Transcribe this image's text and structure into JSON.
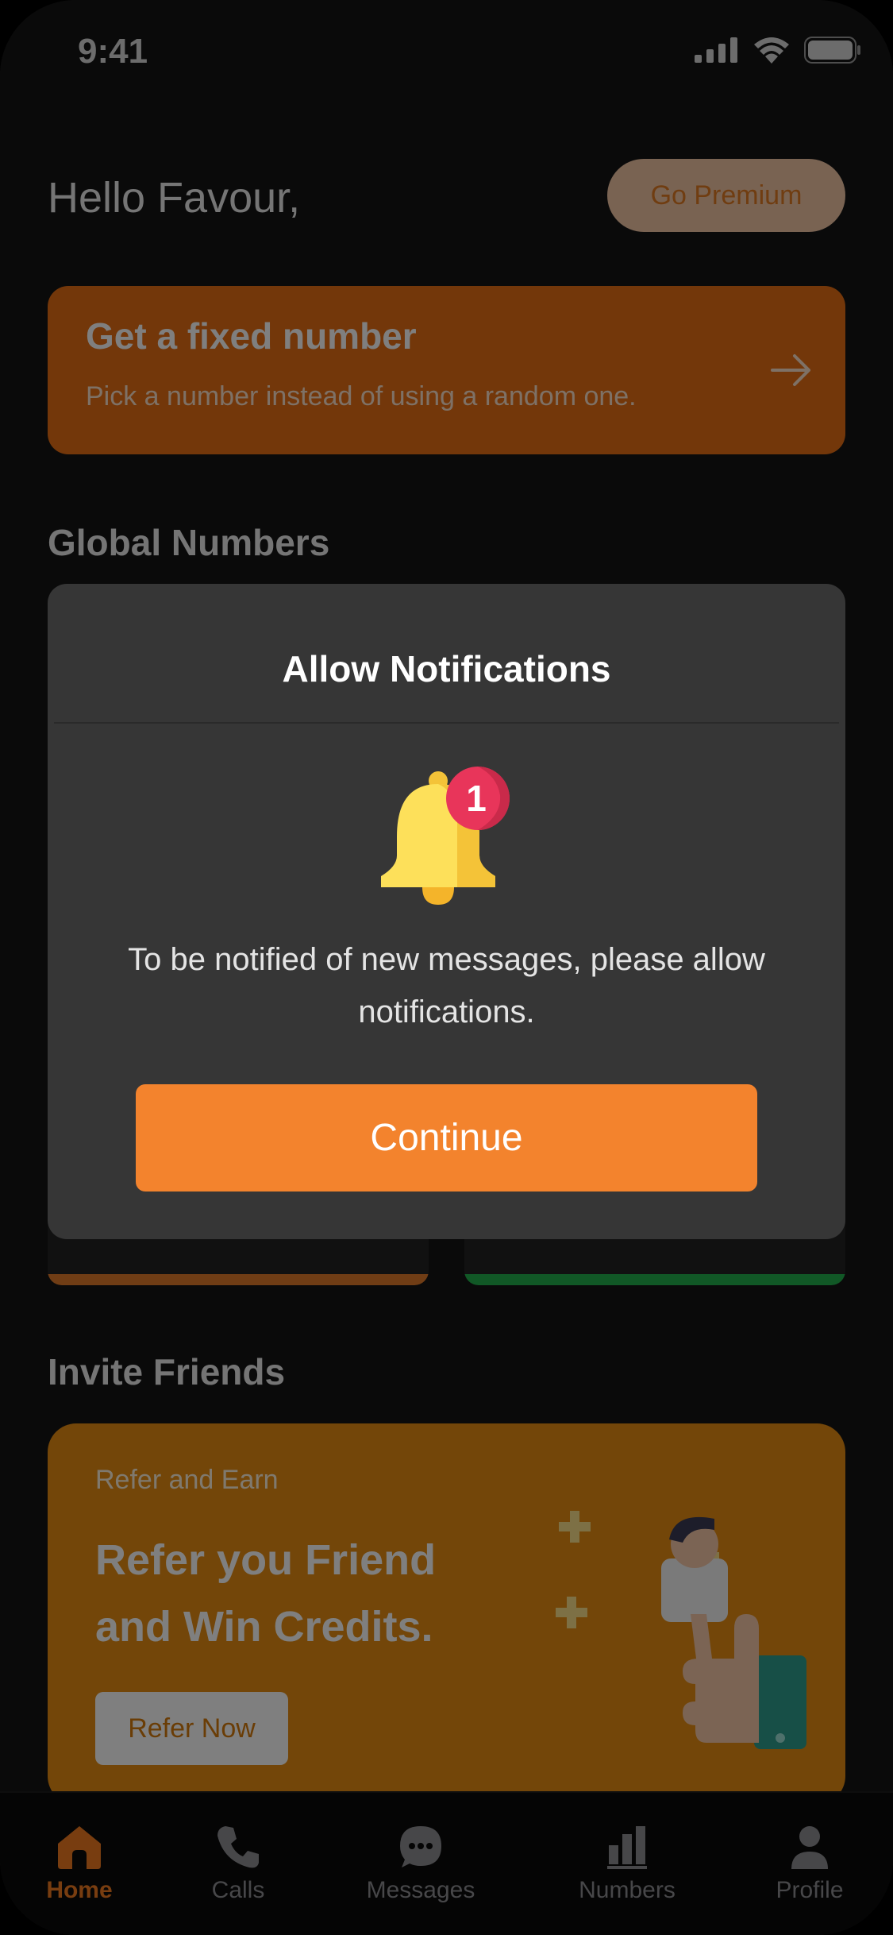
{
  "status_bar": {
    "time": "9:41"
  },
  "header": {
    "greeting": "Hello Favour,",
    "premium_label": "Go Premium"
  },
  "fixed_number": {
    "title": "Get a fixed number",
    "subtitle": "Pick a number instead of using a random one."
  },
  "sections": {
    "global": "Global Numbers",
    "invite": "Invite Friends"
  },
  "number_cards": [
    {
      "accent": "#e07a2a"
    },
    {
      "accent": "#22b14c"
    }
  ],
  "invite": {
    "small": "Refer and Earn",
    "big": "Refer you Friend and Win Credits.",
    "button": "Refer Now"
  },
  "tabbar": {
    "items": [
      {
        "label": "Home",
        "icon": "home-icon",
        "active": true
      },
      {
        "label": "Calls",
        "icon": "phone-icon"
      },
      {
        "label": "Messages",
        "icon": "chat-icon"
      },
      {
        "label": "Numbers",
        "icon": "bar-chart-icon"
      },
      {
        "label": "Profile",
        "icon": "user-icon"
      }
    ]
  },
  "modal": {
    "title": "Allow Notifications",
    "badge": "1",
    "message": "To be notified of new messages, please allow notifications.",
    "button": "Continue"
  },
  "colors": {
    "accent": "#f3832d",
    "card_orange": "#e66f14",
    "invite_bg": "#e68d12",
    "modal_bg": "#363636"
  }
}
